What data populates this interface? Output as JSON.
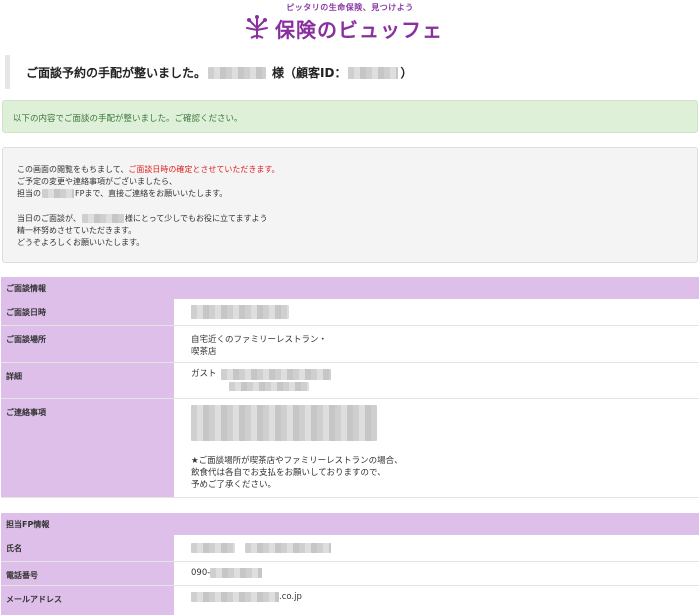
{
  "brand": {
    "tagline": "ピッタリの生命保険、見つけよう",
    "name": "保険のビュッフェ"
  },
  "title": {
    "prefix": "ご面談予約の手配が整いました。",
    "honorific": "様（顧客ID：",
    "suffix": "）"
  },
  "notice_green": "以下の内容でご面談の手配が整いました。ご確認ください。",
  "notice_gray": {
    "line1_a": "この画面の閲覧をもちまして、",
    "line1_b": "ご面談日時の確定とさせていただきます。",
    "line2": "ご予定の変更や連絡事項がございましたら、",
    "line3_a": "担当の",
    "line3_b": "FPまで、直接ご連絡をお願いいたします。",
    "line4_a": "当日のご面談が、",
    "line4_b": "様にとって少しでもお役に立てますよう",
    "line5": "精一杯努めさせていただきます。",
    "line6": "どうぞよろしくお願いいたします。"
  },
  "meeting": {
    "header": "ご面談情報",
    "date_label": "ご面談日時",
    "place_label": "ご面談場所",
    "place_value_1": "自宅近くのファミリーレストラン・",
    "place_value_2": "喫茶店",
    "detail_label": "詳細",
    "detail_value": "ガスト",
    "contact_label": "ご連絡事項",
    "contact_note_1": "★ご面談場所が喫茶店やファミリーレストランの場合、",
    "contact_note_2": "飲食代は各自でお支払をお願いしておりますので、",
    "contact_note_3": "予めご了承ください。"
  },
  "fp": {
    "header": "担当FP情報",
    "name_label": "氏名",
    "phone_label": "電話番号",
    "phone_prefix": "090-",
    "email_label": "メールアドレス",
    "email_suffix": ".co.jp"
  },
  "colors": {
    "accent_purple": "#8a2fa0",
    "table_label_bg": "#ddbfe9",
    "success_bg": "#dff0d8",
    "alert_red": "#e02020"
  }
}
